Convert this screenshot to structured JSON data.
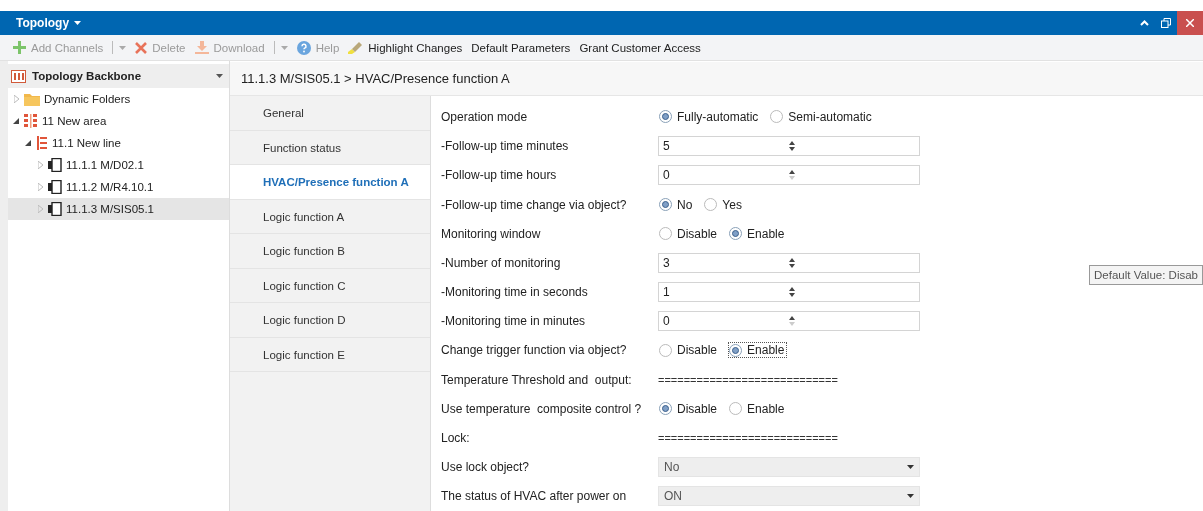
{
  "window": {
    "title": "Topology"
  },
  "toolbar": [
    {
      "kind": "add",
      "label": "Add Channels",
      "disabled": true,
      "menu": true
    },
    {
      "kind": "delete",
      "label": "Delete",
      "disabled": true,
      "menu": false
    },
    {
      "kind": "download",
      "label": "Download",
      "disabled": true,
      "menu": true
    },
    {
      "kind": "help",
      "label": "Help",
      "disabled": true,
      "menu": false
    },
    {
      "kind": "highlight",
      "label": "Highlight Changes",
      "disabled": false,
      "menu": false
    },
    {
      "kind": "plain",
      "label": "Default Parameters",
      "disabled": false,
      "menu": false
    },
    {
      "kind": "plain",
      "label": "Grant Customer Access",
      "disabled": false,
      "menu": false
    }
  ],
  "sidebar": {
    "title": "Topology Backbone",
    "items": [
      {
        "kind": "folder",
        "label": "Dynamic Folders",
        "expanded": false,
        "selected": false
      },
      {
        "kind": "area",
        "label": "11 New area",
        "expanded": true,
        "selected": false,
        "children": [
          {
            "kind": "line",
            "label": "11.1 New line",
            "expanded": true,
            "selected": false,
            "children": [
              {
                "kind": "device",
                "label": "11.1.1 M/D02.1",
                "expanded": false,
                "selected": false
              },
              {
                "kind": "device",
                "label": "11.1.2 M/R4.10.1",
                "expanded": false,
                "selected": false
              },
              {
                "kind": "device",
                "label": "11.1.3 M/SIS05.1",
                "expanded": false,
                "selected": true
              }
            ]
          }
        ]
      }
    ]
  },
  "breadcrumb": "11.1.3 M/SIS05.1 > HVAC/Presence function A",
  "tabs": [
    {
      "label": "General",
      "selected": false
    },
    {
      "label": "Function status",
      "selected": false
    },
    {
      "label": "HVAC/Presence function A",
      "selected": true
    },
    {
      "label": "Logic function A",
      "selected": false
    },
    {
      "label": "Logic function B",
      "selected": false
    },
    {
      "label": "Logic function C",
      "selected": false
    },
    {
      "label": "Logic function D",
      "selected": false
    },
    {
      "label": "Logic function E",
      "selected": false
    }
  ],
  "parameters": [
    {
      "kind": "radio",
      "label": "Operation mode",
      "options": [
        {
          "label": "Fully-automatic",
          "selected": true,
          "focused": false
        },
        {
          "label": "Semi-automatic",
          "selected": false,
          "focused": false
        }
      ]
    },
    {
      "kind": "number",
      "label": "-Follow-up time minutes",
      "value": "5",
      "at_minimum": false
    },
    {
      "kind": "number",
      "label": "-Follow-up time hours",
      "value": "0",
      "at_minimum": true
    },
    {
      "kind": "radio",
      "label": "-Follow-up time change via object?",
      "options": [
        {
          "label": "No",
          "selected": true,
          "focused": false
        },
        {
          "label": "Yes",
          "selected": false,
          "focused": false
        }
      ]
    },
    {
      "kind": "radio",
      "label": "Monitoring window",
      "options": [
        {
          "label": "Disable",
          "selected": false,
          "focused": false
        },
        {
          "label": "Enable",
          "selected": true,
          "focused": false
        }
      ]
    },
    {
      "kind": "number",
      "label": "-Number of monitoring",
      "value": "3",
      "at_minimum": false
    },
    {
      "kind": "number",
      "label": "-Monitoring time in seconds",
      "value": "1",
      "at_minimum": false
    },
    {
      "kind": "number",
      "label": "-Monitoring time in minutes",
      "value": "0",
      "at_minimum": true
    },
    {
      "kind": "radio",
      "label": "Change trigger function via object?",
      "options": [
        {
          "label": "Disable",
          "selected": false,
          "focused": false
        },
        {
          "label": "Enable",
          "selected": true,
          "focused": true
        }
      ]
    },
    {
      "kind": "separator",
      "label": "Temperature Threshold and  output:",
      "value": "============================"
    },
    {
      "kind": "radio",
      "label": "Use temperature  composite control ?",
      "options": [
        {
          "label": "Disable",
          "selected": true,
          "focused": false
        },
        {
          "label": "Enable",
          "selected": false,
          "focused": false
        }
      ]
    },
    {
      "kind": "separator",
      "label": "Lock:",
      "value": "============================"
    },
    {
      "kind": "dropdown",
      "label": "Use lock object?",
      "value": "No"
    },
    {
      "kind": "dropdown",
      "label": "The status of HVAC after power on",
      "value": "ON"
    }
  ],
  "tooltip": "Default Value: Disab"
}
